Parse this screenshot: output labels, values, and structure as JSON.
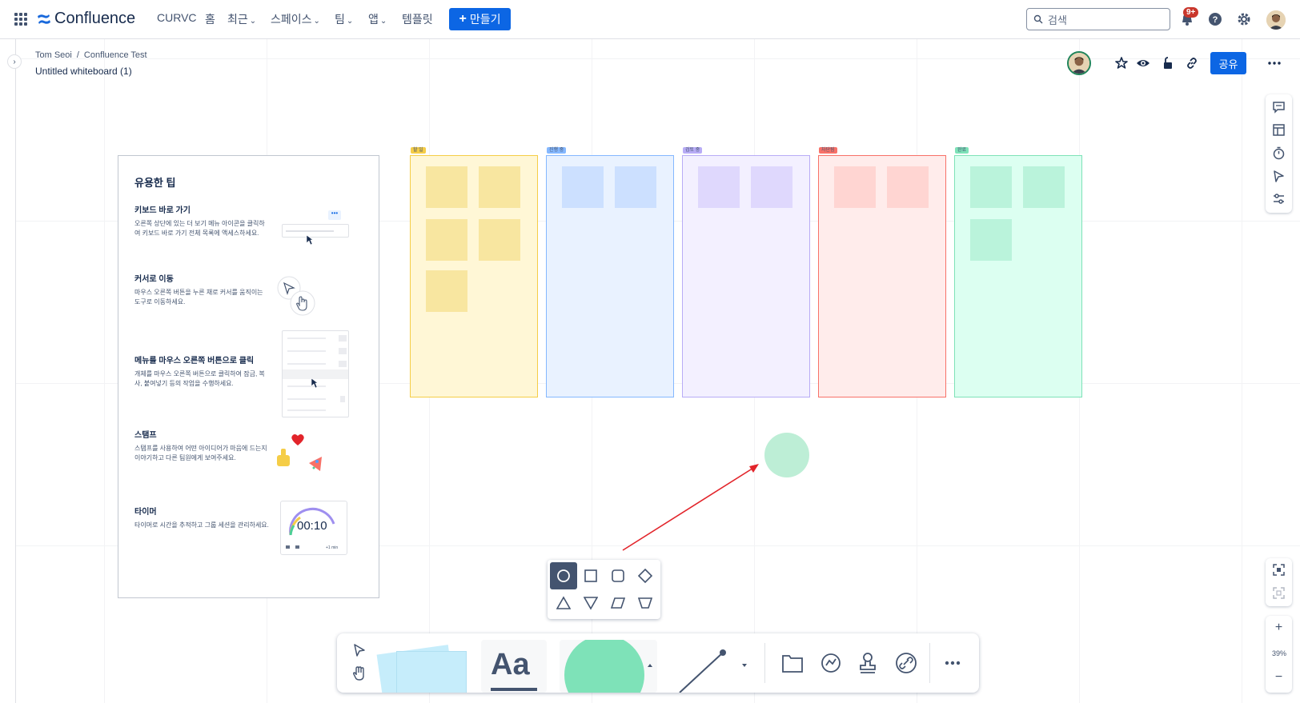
{
  "topnav": {
    "brand": "Confluence",
    "space": "CURVC",
    "home": "홈",
    "recent": "최근",
    "spaces": "스페이스",
    "teams": "팀",
    "apps": "앱",
    "templates": "템플릿",
    "create": "만들기",
    "search_placeholder": "검색",
    "notif_badge": "9+"
  },
  "breadcrumb": {
    "items": [
      "Tom Seoi",
      "Confluence Test"
    ],
    "separator": "/"
  },
  "page": {
    "title": "Untitled whiteboard (1)",
    "share": "공유"
  },
  "tips": {
    "heading": "유용한 팁",
    "items": [
      {
        "title": "키보드 바로 가기",
        "desc": "오른쪽 상단에 있는 더 보기 메뉴 아이콘을 클릭하여 키보드 바로 가기 전체 목록에 액세스하세요."
      },
      {
        "title": "커서로 이동",
        "desc": "마우스 오른쪽 버튼을 누른 채로 커서를 움직이는 도구로 이동하세요."
      },
      {
        "title": "메뉴를 마우스 오른쪽 버튼으로 클릭",
        "desc": "개체를 마우스 오른쪽 버튼으로 클릭하여 잠금, 복사, 붙여넣기 등의 작업을 수행하세요."
      },
      {
        "title": "스탬프",
        "desc": "스탬프를 사용하여 어떤 아이디어가 마음에 드는지 이야기하고 다른 팀원에게 보여주세요."
      },
      {
        "title": "타이머",
        "desc": "타이머로 시간을 추적하고 그룹 세션을 관리하세요."
      }
    ],
    "timer_value": "00:10",
    "timer_plus": "+1 min"
  },
  "columns": [
    {
      "tag": "할 일",
      "bg": "#fff7d6",
      "border": "#f5cd47",
      "note": "#f8e6a0",
      "notes": 5
    },
    {
      "tag": "진행 중",
      "bg": "#e9f2ff",
      "border": "#85b8ff",
      "note": "#cce0ff",
      "notes": 2
    },
    {
      "tag": "검토 중",
      "bg": "#f3f0ff",
      "border": "#b8acf6",
      "note": "#dfd8fd",
      "notes": 2
    },
    {
      "tag": "차단됨",
      "bg": "#ffeceb",
      "border": "#f87168",
      "note": "#ffd5d2",
      "notes": 2
    },
    {
      "tag": "완료",
      "bg": "#dcfff1",
      "border": "#7ee2b8",
      "note": "#baf3db",
      "notes": 3
    }
  ],
  "colors": {
    "accent": "#0c66e4",
    "shape_green": "#b3ecd3",
    "arrow_red": "#e2242a",
    "selected_shape_bg": "#44546f"
  },
  "shape_picker": {
    "options": [
      "circle-icon",
      "square-icon",
      "rounded-square-icon",
      "diamond-icon",
      "triangle-icon",
      "inverted-triangle-icon",
      "parallelogram-icon",
      "trapezoid-icon"
    ],
    "selected": "circle-icon"
  },
  "toolbar": {
    "text_label": "Aa"
  },
  "zoom": {
    "level": "39%",
    "plus": "+",
    "minus": "−"
  }
}
